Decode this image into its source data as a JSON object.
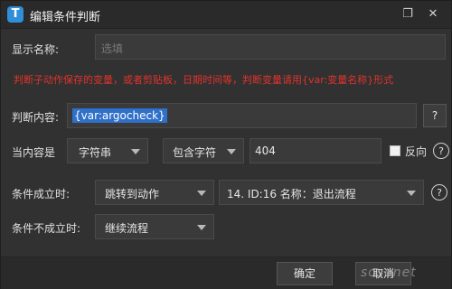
{
  "window": {
    "app_icon_letter": "T",
    "title": "编辑条件判断",
    "restore_glyph": "❐",
    "close_glyph": "✕"
  },
  "display_name": {
    "label": "显示名称:",
    "placeholder": "选填"
  },
  "hint": "判断子动作保存的变量，或者剪贴板，日期时间等，判断变量请用{var:变量名称}形式",
  "judge_content": {
    "label": "判断内容:",
    "value": "{var:argocheck}",
    "picker_button": "?"
  },
  "when_content": {
    "label": "当内容是",
    "type_select": "字符串",
    "operator_select": "包含字符",
    "value": "404",
    "reverse_label": "反向",
    "reverse_checked": false,
    "help": "?"
  },
  "on_true": {
    "label": "条件成立时:",
    "action_select": "跳转到动作",
    "target_select": "14. ID:16 名称：退出流程",
    "help": "?"
  },
  "on_false": {
    "label": "条件不成立时:",
    "action_select": "继续流程"
  },
  "footer": {
    "ok": "确定",
    "cancel": "取消"
  },
  "watermark": "sosonet",
  "icons": {
    "app": "app-logo-icon",
    "close": "close-icon",
    "restore": "restore-icon",
    "help": "help-circle-icon",
    "caret": "chevron-down-icon"
  }
}
